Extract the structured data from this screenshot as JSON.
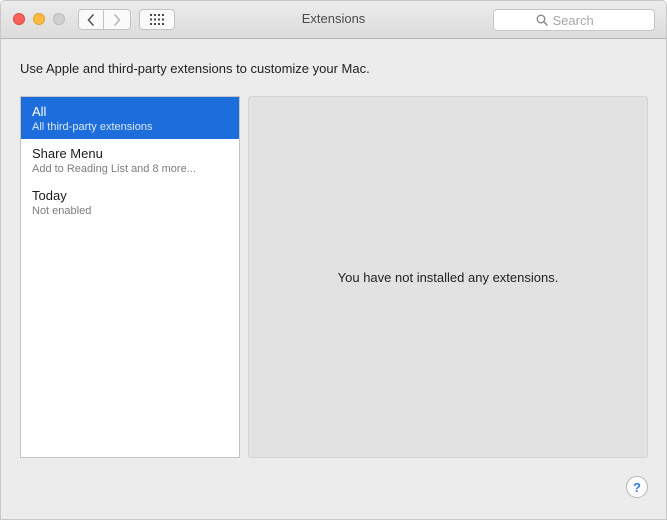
{
  "window": {
    "title": "Extensions"
  },
  "toolbar": {
    "back_icon": "chevron-left-icon",
    "forward_icon": "chevron-right-icon",
    "show_all_icon": "grid-icon",
    "search": {
      "placeholder": "Search",
      "value": ""
    }
  },
  "main": {
    "description": "Use Apple and third-party extensions to customize your Mac."
  },
  "sidebar": {
    "items": [
      {
        "title": "All",
        "subtitle": "All third-party extensions",
        "selected": true
      },
      {
        "title": "Share Menu",
        "subtitle": "Add to Reading List and 8 more...",
        "selected": false
      },
      {
        "title": "Today",
        "subtitle": "Not enabled",
        "selected": false
      }
    ]
  },
  "detail": {
    "message": "You have not installed any extensions."
  },
  "help": {
    "label": "?"
  },
  "colors": {
    "accent": "#1d6ddc",
    "close": "#fc605c",
    "minimize": "#fdbc40",
    "zoom": "#d0d0d0",
    "help": "#2d7be3"
  }
}
